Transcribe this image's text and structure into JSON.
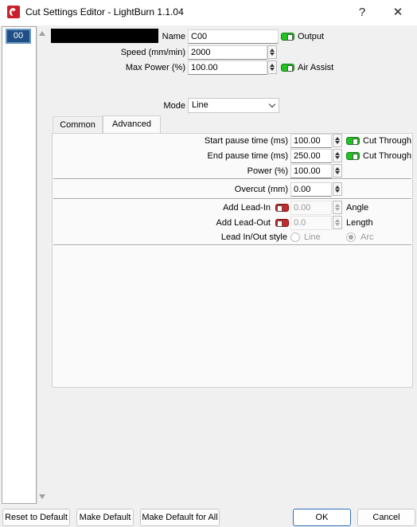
{
  "window": {
    "title": "Cut Settings Editor - LightBurn 1.1.04",
    "help_label": "?",
    "close_label": "✕"
  },
  "layers": [
    {
      "label": "00",
      "color": "#1f4f85"
    }
  ],
  "main": {
    "name_label": "Name",
    "name_value": "C00",
    "output_label": "Output",
    "output_on": true,
    "speed_label": "Speed (mm/min)",
    "speed_value": "2000",
    "max_power_label": "Max Power (%)",
    "max_power_value": "100.00",
    "air_assist_label": "Air Assist",
    "air_assist_on": true,
    "mode_label": "Mode",
    "mode_value": "Line",
    "layer_color": "#000000"
  },
  "tabs": [
    {
      "label": "Common",
      "active": false
    },
    {
      "label": "Advanced",
      "active": true
    }
  ],
  "advanced": {
    "start_pause_label": "Start pause time (ms)",
    "start_pause_value": "100.00",
    "start_cut_through_label": "Cut Through",
    "end_pause_label": "End pause time (ms)",
    "end_pause_value": "250.00",
    "end_cut_through_label": "Cut Through",
    "power_label": "Power (%)",
    "power_value": "100.00",
    "overcut_label": "Overcut (mm)",
    "overcut_value": "0.00",
    "add_lead_in_label": "Add Lead-In",
    "lead_in_value": "0.00",
    "angle_label": "Angle",
    "add_lead_out_label": "Add Lead-Out",
    "lead_out_value": "0.0",
    "length_label": "Length",
    "lead_style_label": "Lead In/Out style",
    "line_option_label": "Line",
    "arc_option_label": "Arc"
  },
  "footer": {
    "reset_label": "Reset to Default",
    "make_default_label": "Make Default",
    "make_default_all_label": "Make Default for All",
    "ok_label": "OK",
    "cancel_label": "Cancel"
  },
  "colors": {
    "toggle_on": "#21c321",
    "toggle_off": "#c62a2a",
    "accent": "#2f6dbd"
  }
}
